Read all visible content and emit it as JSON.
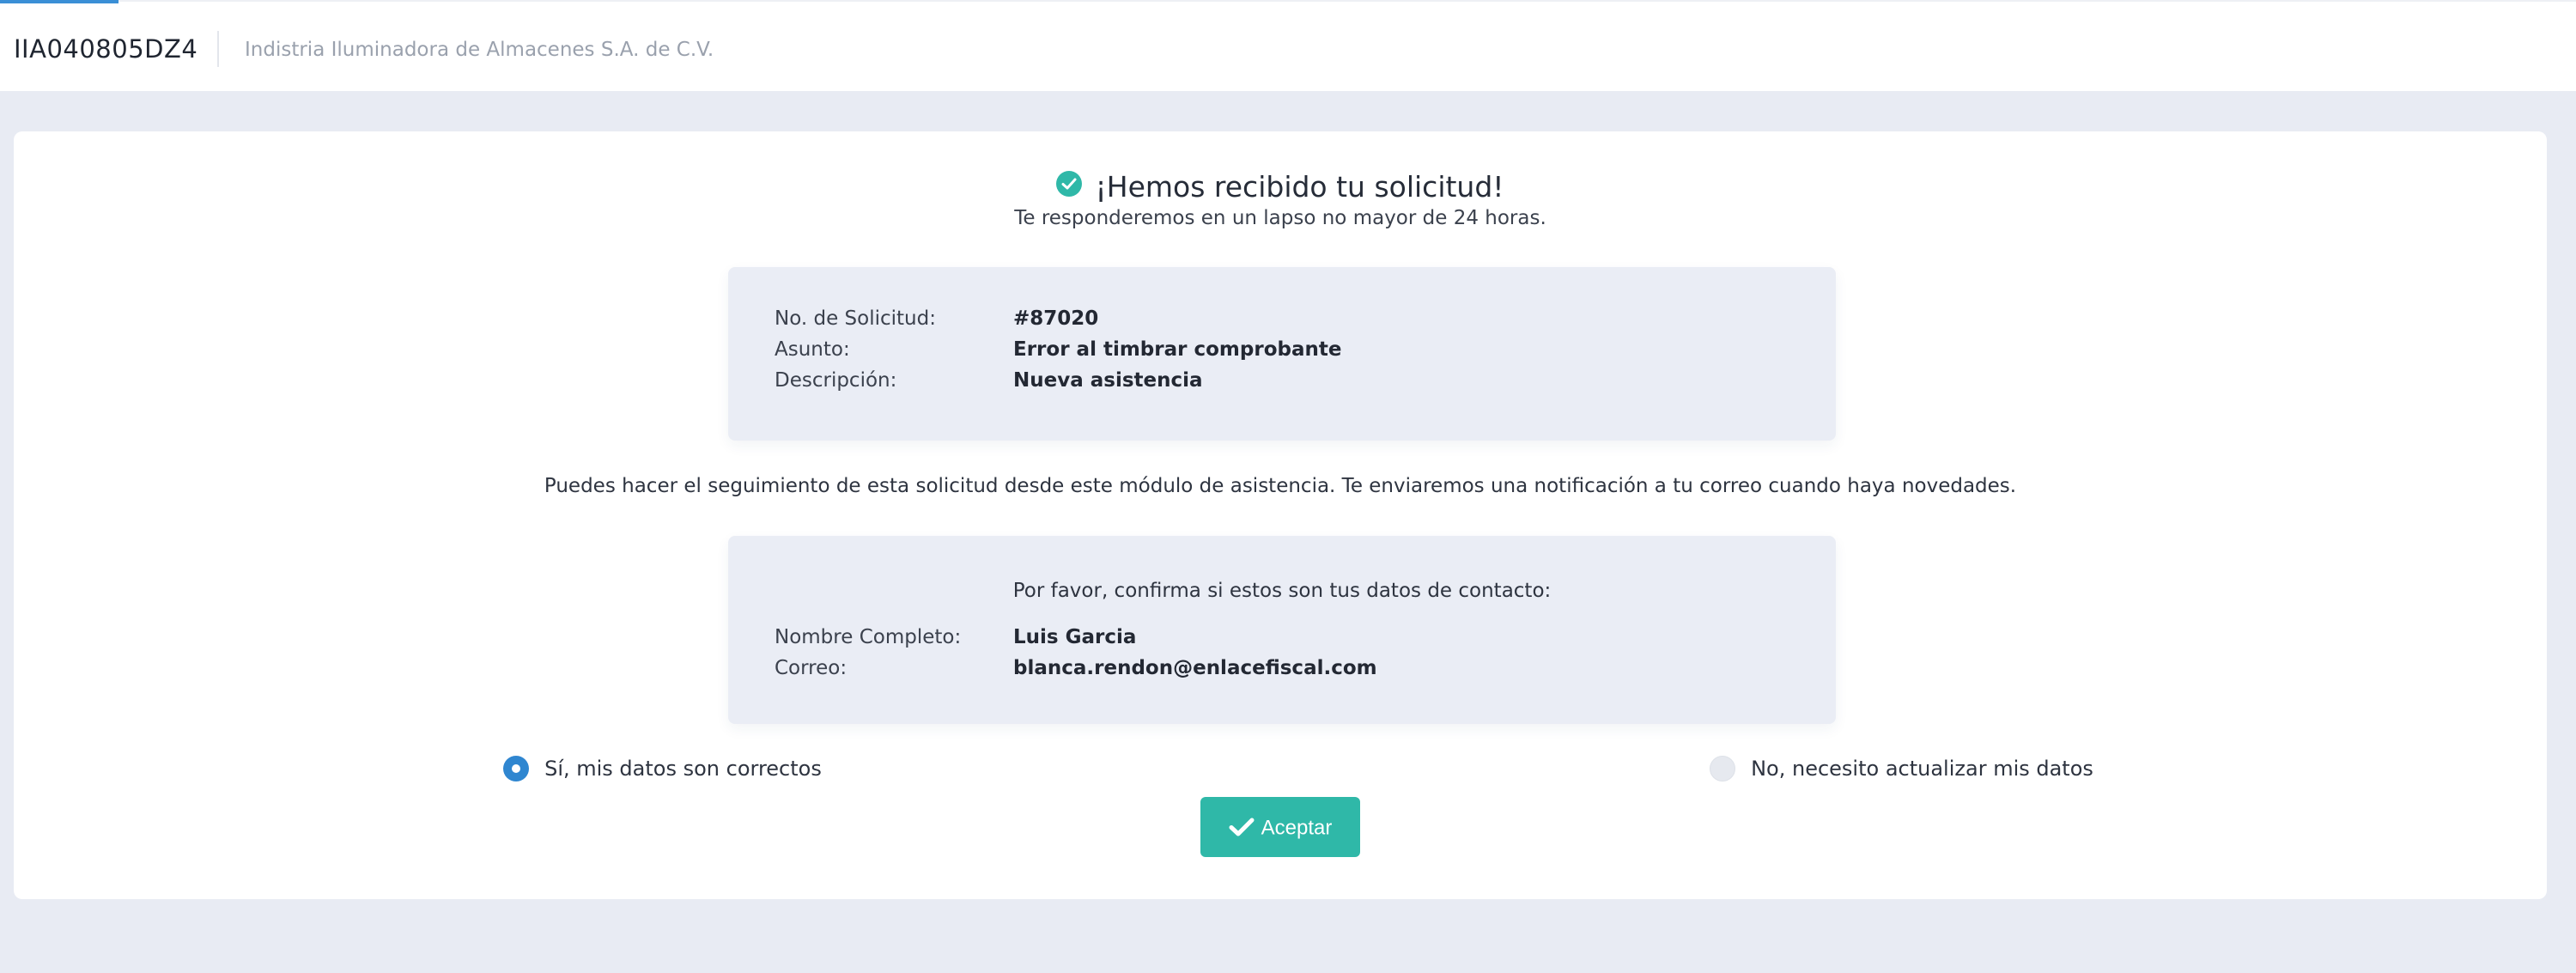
{
  "header": {
    "rfc": "IIA040805DZ4",
    "company_name": "Indistria Iluminadora de Almacenes S.A. de C.V."
  },
  "confirmation": {
    "title": "¡Hemos recibido tu solicitud!",
    "subtitle": "Te responderemos en un lapso no mayor de 24 horas.",
    "icon": "check-circle-icon"
  },
  "request": {
    "number_label": "No. de Solicitud:",
    "number_value": "#87020",
    "subject_label": "Asunto:",
    "subject_value": "Error al timbrar comprobante",
    "description_label": "Descripción:",
    "description_value": "Nueva asistencia"
  },
  "tracking_note": "Puedes hacer el seguimiento de esta solicitud desde este módulo de asistencia. Te enviaremos una notificación a tu correo cuando haya novedades.",
  "contact": {
    "prompt": "Por favor, confirma si estos son tus datos de contacto:",
    "name_label": "Nombre Completo:",
    "name_value": "Luis Garcia",
    "email_label": "Correo:",
    "email_value": "blanca.rendon@enlacefiscal.com"
  },
  "options": {
    "yes_label": "Sí, mis datos son correctos",
    "no_label": "No, necesito actualizar mis datos",
    "selected": "yes"
  },
  "actions": {
    "accept_label": "Aceptar"
  },
  "colors": {
    "accent_teal": "#2fb8a8",
    "accent_blue": "#2f86d0",
    "page_background": "#e8ebf3",
    "infobox_background": "#eaedf5"
  }
}
